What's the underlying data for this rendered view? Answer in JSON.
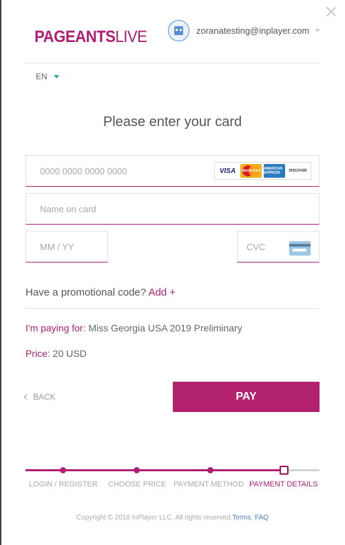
{
  "brand": {
    "name_bold": "PAGEANTS",
    "name_light": "LIVE"
  },
  "user": {
    "email": "zoranatesting@inplayer.com"
  },
  "language": {
    "selected": "EN"
  },
  "heading": "Please enter your card",
  "form": {
    "card_number_placeholder": "0000 0000 0000 0000",
    "name_placeholder": "Name on card",
    "expiry_placeholder": "MM / YY",
    "cvc_placeholder": "CVC",
    "card_logos": [
      "VISA",
      "MasterCard",
      "AMERICAN EXPRESS",
      "DISCOVER"
    ]
  },
  "promo": {
    "question": "Have a promotional code?",
    "add_label": "Add +"
  },
  "purchase": {
    "paying_for_label": "I'm paying for",
    "paying_for_value": ": Miss Georgia USA 2019 Preliminary",
    "price_label": "Price",
    "price_value": ": 20 USD"
  },
  "actions": {
    "back_label": "BACK",
    "pay_label": "PAY"
  },
  "steps": [
    {
      "label": "LOGIN / REGISTER",
      "state": "done"
    },
    {
      "label": "CHOOSE PRICE",
      "state": "done"
    },
    {
      "label": "PAYMENT METHOD",
      "state": "done"
    },
    {
      "label": "PAYMENT DETAILS",
      "state": "current"
    }
  ],
  "footer": {
    "copyright": "Copyright © 2018 InPlayer LLC, All rights reserved.",
    "terms": "Terms",
    "separator": ",",
    "faq": "FAQ"
  },
  "colors": {
    "accent": "#b01e74",
    "link": "#4e7fc0",
    "language_caret": "#2fa6a0"
  }
}
